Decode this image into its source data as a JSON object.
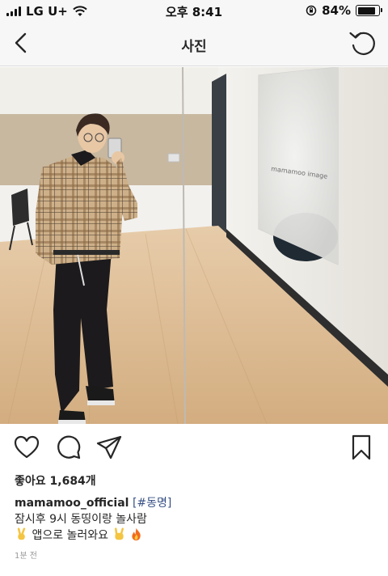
{
  "status_bar": {
    "carrier": "LG U+",
    "time": "오후 8:41",
    "battery": "84%",
    "battery_level": 0.84
  },
  "nav": {
    "title": "사진",
    "back_icon": "chevron-left-icon",
    "right_icon": "refresh-icon"
  },
  "post": {
    "likes_label": "좋아요 1,684개",
    "username": "mamamoo_official",
    "hashtag": "[#동명]",
    "caption_line_1": "잠시후 9시 동띵이랑 놀사람",
    "caption_line_2": "앱으로 놀러와요",
    "timestamp": "1분 전",
    "icons": [
      "heart-icon",
      "comment-icon",
      "share-icon",
      "bookmark-icon"
    ],
    "emoji_icons": [
      "victory-hand-emoji",
      "rock-hand-emoji",
      "fire-emoji"
    ],
    "poster_text": "mamamoo image"
  }
}
